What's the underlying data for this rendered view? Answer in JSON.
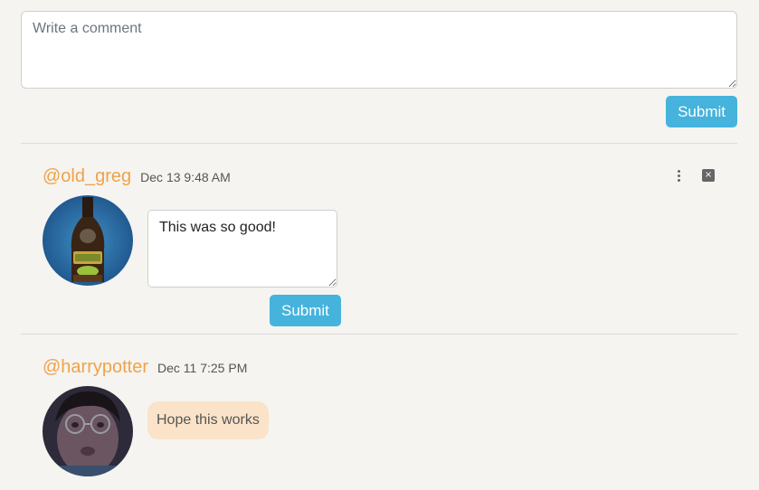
{
  "new_comment": {
    "placeholder": "Write a comment",
    "submit_label": "Submit"
  },
  "comments": [
    {
      "username": "@old_greg",
      "timestamp": "Dec 13 9:48 AM",
      "avatar_icon": "bottle-avatar",
      "edit_value": "This was so good!",
      "submit_label": "Submit",
      "menu_icon": "kebab-menu-icon",
      "close_icon": "close-icon",
      "close_glyph": "×"
    },
    {
      "username": "@harrypotter",
      "timestamp": "Dec 11 7:25 PM",
      "avatar_icon": "person-avatar",
      "text": "Hope this works"
    }
  ],
  "colors": {
    "background": "#f5f4f0",
    "username": "#f0a24a",
    "button": "#45b3dc",
    "bubble": "#fbe3c9"
  }
}
